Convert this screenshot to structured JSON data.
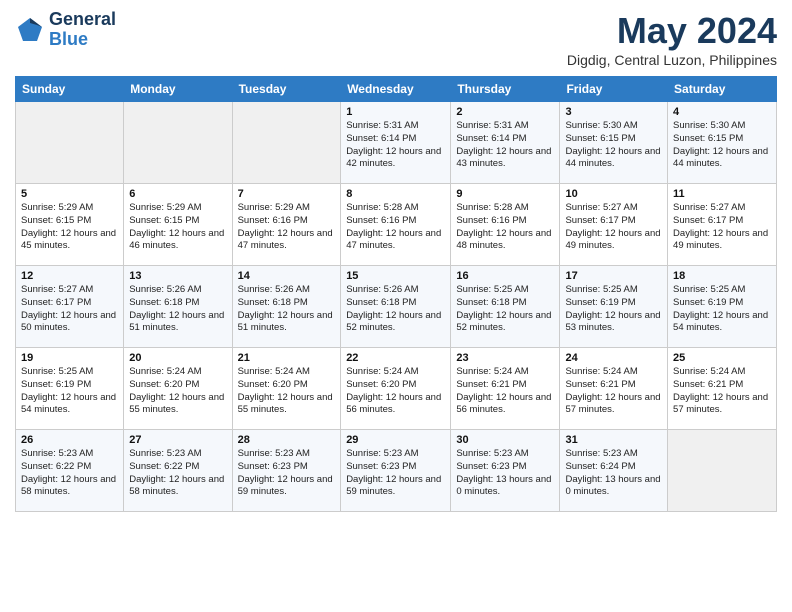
{
  "header": {
    "logo_general": "General",
    "logo_blue": "Blue",
    "title": "May 2024",
    "subtitle": "Digdig, Central Luzon, Philippines"
  },
  "days_of_week": [
    "Sunday",
    "Monday",
    "Tuesday",
    "Wednesday",
    "Thursday",
    "Friday",
    "Saturday"
  ],
  "weeks": [
    [
      {
        "day": "",
        "info": ""
      },
      {
        "day": "",
        "info": ""
      },
      {
        "day": "",
        "info": ""
      },
      {
        "day": "1",
        "info": "Sunrise: 5:31 AM\nSunset: 6:14 PM\nDaylight: 12 hours\nand 42 minutes."
      },
      {
        "day": "2",
        "info": "Sunrise: 5:31 AM\nSunset: 6:14 PM\nDaylight: 12 hours\nand 43 minutes."
      },
      {
        "day": "3",
        "info": "Sunrise: 5:30 AM\nSunset: 6:15 PM\nDaylight: 12 hours\nand 44 minutes."
      },
      {
        "day": "4",
        "info": "Sunrise: 5:30 AM\nSunset: 6:15 PM\nDaylight: 12 hours\nand 44 minutes."
      }
    ],
    [
      {
        "day": "5",
        "info": "Sunrise: 5:29 AM\nSunset: 6:15 PM\nDaylight: 12 hours\nand 45 minutes."
      },
      {
        "day": "6",
        "info": "Sunrise: 5:29 AM\nSunset: 6:15 PM\nDaylight: 12 hours\nand 46 minutes."
      },
      {
        "day": "7",
        "info": "Sunrise: 5:29 AM\nSunset: 6:16 PM\nDaylight: 12 hours\nand 47 minutes."
      },
      {
        "day": "8",
        "info": "Sunrise: 5:28 AM\nSunset: 6:16 PM\nDaylight: 12 hours\nand 47 minutes."
      },
      {
        "day": "9",
        "info": "Sunrise: 5:28 AM\nSunset: 6:16 PM\nDaylight: 12 hours\nand 48 minutes."
      },
      {
        "day": "10",
        "info": "Sunrise: 5:27 AM\nSunset: 6:17 PM\nDaylight: 12 hours\nand 49 minutes."
      },
      {
        "day": "11",
        "info": "Sunrise: 5:27 AM\nSunset: 6:17 PM\nDaylight: 12 hours\nand 49 minutes."
      }
    ],
    [
      {
        "day": "12",
        "info": "Sunrise: 5:27 AM\nSunset: 6:17 PM\nDaylight: 12 hours\nand 50 minutes."
      },
      {
        "day": "13",
        "info": "Sunrise: 5:26 AM\nSunset: 6:18 PM\nDaylight: 12 hours\nand 51 minutes."
      },
      {
        "day": "14",
        "info": "Sunrise: 5:26 AM\nSunset: 6:18 PM\nDaylight: 12 hours\nand 51 minutes."
      },
      {
        "day": "15",
        "info": "Sunrise: 5:26 AM\nSunset: 6:18 PM\nDaylight: 12 hours\nand 52 minutes."
      },
      {
        "day": "16",
        "info": "Sunrise: 5:25 AM\nSunset: 6:18 PM\nDaylight: 12 hours\nand 52 minutes."
      },
      {
        "day": "17",
        "info": "Sunrise: 5:25 AM\nSunset: 6:19 PM\nDaylight: 12 hours\nand 53 minutes."
      },
      {
        "day": "18",
        "info": "Sunrise: 5:25 AM\nSunset: 6:19 PM\nDaylight: 12 hours\nand 54 minutes."
      }
    ],
    [
      {
        "day": "19",
        "info": "Sunrise: 5:25 AM\nSunset: 6:19 PM\nDaylight: 12 hours\nand 54 minutes."
      },
      {
        "day": "20",
        "info": "Sunrise: 5:24 AM\nSunset: 6:20 PM\nDaylight: 12 hours\nand 55 minutes."
      },
      {
        "day": "21",
        "info": "Sunrise: 5:24 AM\nSunset: 6:20 PM\nDaylight: 12 hours\nand 55 minutes."
      },
      {
        "day": "22",
        "info": "Sunrise: 5:24 AM\nSunset: 6:20 PM\nDaylight: 12 hours\nand 56 minutes."
      },
      {
        "day": "23",
        "info": "Sunrise: 5:24 AM\nSunset: 6:21 PM\nDaylight: 12 hours\nand 56 minutes."
      },
      {
        "day": "24",
        "info": "Sunrise: 5:24 AM\nSunset: 6:21 PM\nDaylight: 12 hours\nand 57 minutes."
      },
      {
        "day": "25",
        "info": "Sunrise: 5:24 AM\nSunset: 6:21 PM\nDaylight: 12 hours\nand 57 minutes."
      }
    ],
    [
      {
        "day": "26",
        "info": "Sunrise: 5:23 AM\nSunset: 6:22 PM\nDaylight: 12 hours\nand 58 minutes."
      },
      {
        "day": "27",
        "info": "Sunrise: 5:23 AM\nSunset: 6:22 PM\nDaylight: 12 hours\nand 58 minutes."
      },
      {
        "day": "28",
        "info": "Sunrise: 5:23 AM\nSunset: 6:23 PM\nDaylight: 12 hours\nand 59 minutes."
      },
      {
        "day": "29",
        "info": "Sunrise: 5:23 AM\nSunset: 6:23 PM\nDaylight: 12 hours\nand 59 minutes."
      },
      {
        "day": "30",
        "info": "Sunrise: 5:23 AM\nSunset: 6:23 PM\nDaylight: 13 hours\nand 0 minutes."
      },
      {
        "day": "31",
        "info": "Sunrise: 5:23 AM\nSunset: 6:24 PM\nDaylight: 13 hours\nand 0 minutes."
      },
      {
        "day": "",
        "info": ""
      }
    ]
  ]
}
